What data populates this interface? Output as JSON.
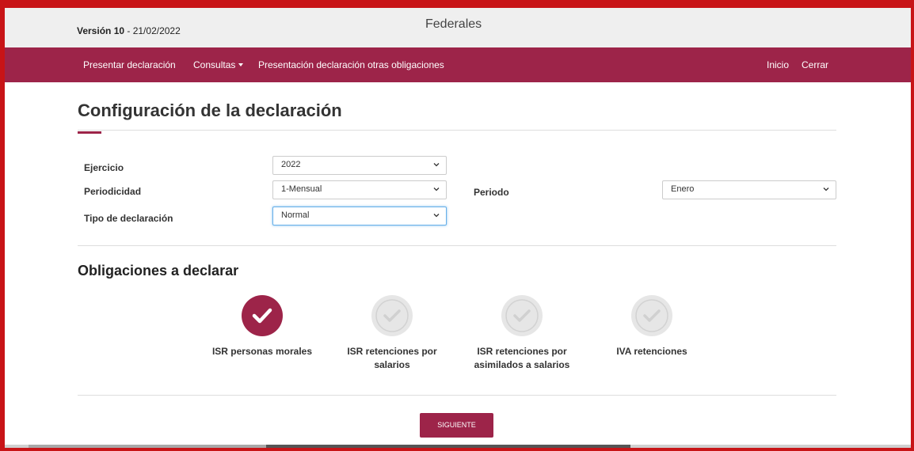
{
  "header": {
    "version_label": "Versión 10",
    "version_date": " - 21/02/2022",
    "brand": "Federales"
  },
  "nav": {
    "left": [
      "Presentar declaración",
      "Consultas",
      "Presentación declaración otras obligaciones"
    ],
    "right": [
      "Inicio",
      "Cerrar"
    ]
  },
  "page": {
    "title": "Configuración de la declaración"
  },
  "form": {
    "ejercicio_label": "Ejercicio",
    "ejercicio_value": "2022",
    "periodicidad_label": "Periodicidad",
    "periodicidad_value": "1-Mensual",
    "periodo_label": "Periodo",
    "periodo_value": "Enero",
    "tipo_label": "Tipo de declaración",
    "tipo_value": "Normal"
  },
  "obligaciones": {
    "title": "Obligaciones a declarar",
    "items": [
      {
        "label": "ISR personas morales",
        "selected": true
      },
      {
        "label": "ISR retenciones por salarios",
        "selected": false
      },
      {
        "label": "ISR retenciones por asimilados a salarios",
        "selected": false
      },
      {
        "label": "IVA retenciones",
        "selected": false
      }
    ]
  },
  "actions": {
    "next_label": "SIGUIENTE"
  },
  "colors": {
    "brand": "#9d2449",
    "frame": "#c81417"
  }
}
